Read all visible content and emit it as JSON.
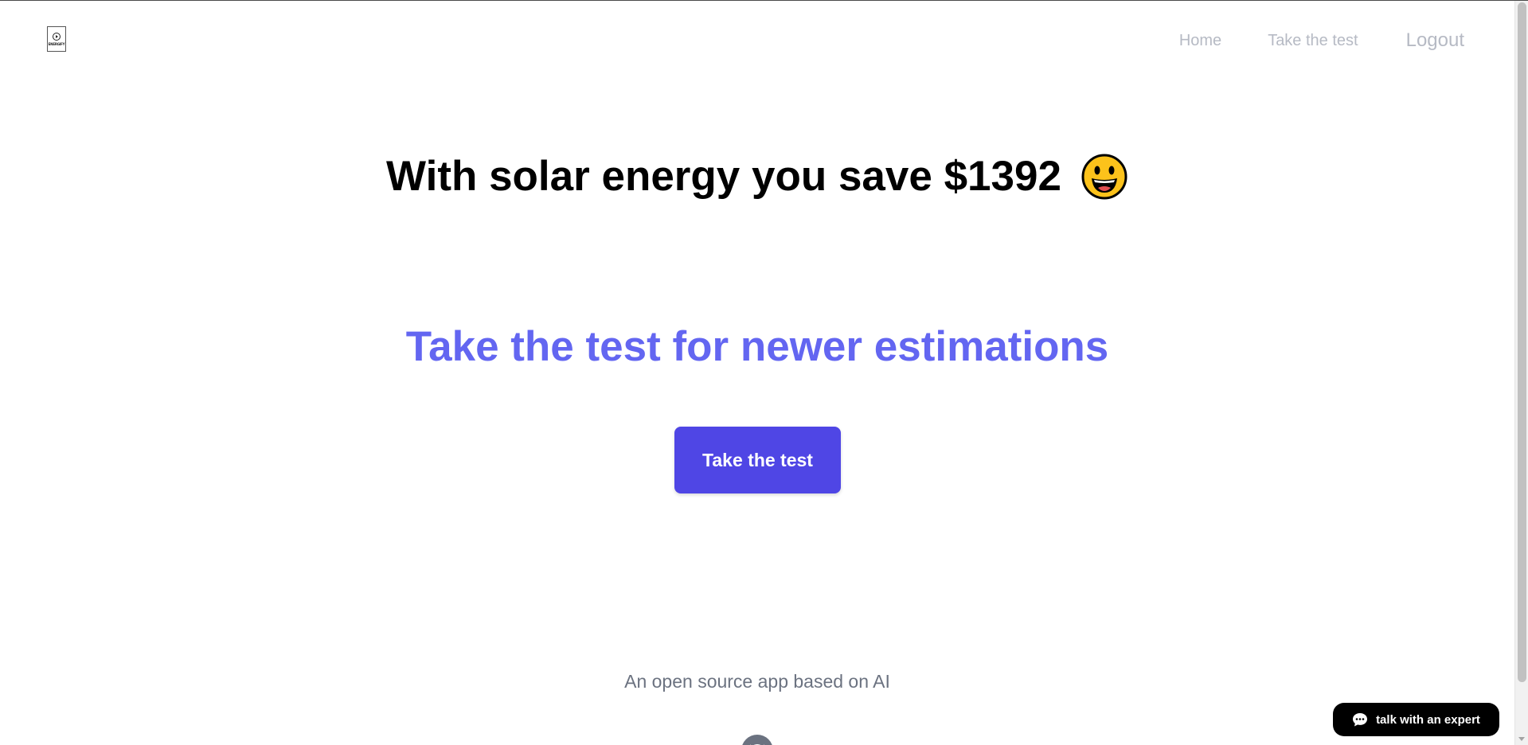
{
  "header": {
    "logo_icon": "energy-logo",
    "logo_text": "ENERGIFY",
    "nav": {
      "home": "Home",
      "take_test": "Take the test",
      "logout": "Logout"
    },
    "nav_color": "#b6bac4"
  },
  "hero": {
    "headline": "With solar energy you save $1392",
    "headline_icon": "smiley-face-emoji",
    "subheadline": "Take the test for newer estimations",
    "subheadline_color": "#6366f1",
    "cta_label": "Take the test",
    "cta_color": "#4f46e5"
  },
  "footer": {
    "tagline": "An open source app based on AI",
    "github_icon": "github-icon"
  },
  "chat_widget": {
    "label": "talk with an expert",
    "icon": "chat-bubble-icon"
  }
}
